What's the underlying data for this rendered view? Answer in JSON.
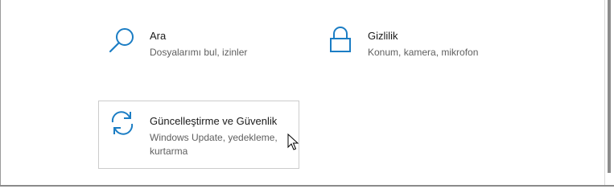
{
  "settings": {
    "tiles": [
      {
        "title": "Ara",
        "subtitle": "Dosyalarımı bul, izinler",
        "icon": "search-icon"
      },
      {
        "title": "Gizlilik",
        "subtitle": "Konum, kamera, mikrofon",
        "icon": "lock-icon"
      },
      {
        "title": "Güncelleştirme ve Güvenlik",
        "subtitle_line1": "Windows Update, yedekleme,",
        "subtitle_line2": "kurtarma",
        "icon": "sync-icon",
        "hovered": true
      }
    ]
  },
  "colors": {
    "accent": "#1b7dc4",
    "title_text": "#1a1a1a",
    "subtitle_text": "#5f5f5f",
    "hover_border": "#cccccc"
  }
}
